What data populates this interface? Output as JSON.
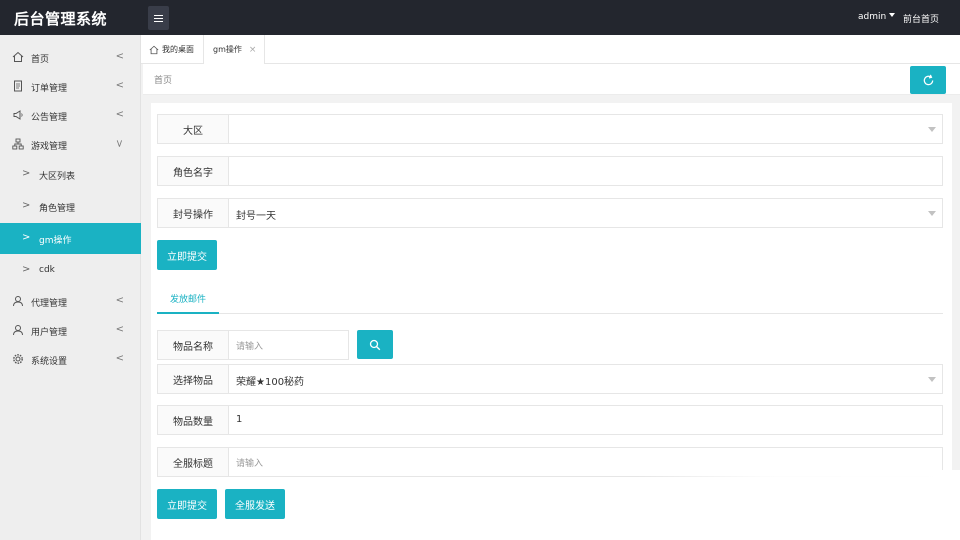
{
  "header": {
    "brand": "后台管理系统",
    "user": "admin",
    "home_link": "前台首页"
  },
  "sidebar": {
    "items": [
      {
        "label": "首页",
        "icon": "home-icon"
      },
      {
        "label": "订单管理",
        "icon": "document-icon"
      },
      {
        "label": "公告管理",
        "icon": "megaphone-icon"
      },
      {
        "label": "游戏管理",
        "icon": "sitemap-icon"
      },
      {
        "label": "代理管理",
        "icon": "user-icon"
      },
      {
        "label": "用户管理",
        "icon": "user-icon"
      },
      {
        "label": "系统设置",
        "icon": "gear-icon"
      }
    ],
    "sub_items": [
      {
        "label": "大区列表"
      },
      {
        "label": "角色管理"
      },
      {
        "label": "gm操作"
      },
      {
        "label": "cdk"
      }
    ]
  },
  "tabs": [
    {
      "label": "我的桌面"
    },
    {
      "label": "gm操作"
    }
  ],
  "breadcrumb": "首页",
  "form1": {
    "region_label": "大区",
    "role_label": "角色名字",
    "ban_label": "封号操作",
    "ban_value": "封号一天",
    "submit_label": "立即提交"
  },
  "mail": {
    "tab_label": "发放邮件",
    "item_name_label": "物品名称",
    "item_name_placeholder": "请输入",
    "select_item_label": "选择物品",
    "select_item_value": "荣耀★100秘药",
    "quantity_label": "物品数量",
    "quantity_value": "1",
    "title_label": "全服标题",
    "title_placeholder": "请输入",
    "submit_label": "立即提交",
    "broadcast_label": "全服发送"
  },
  "colors": {
    "accent": "#1ab2c3",
    "topbar": "#23262e"
  }
}
